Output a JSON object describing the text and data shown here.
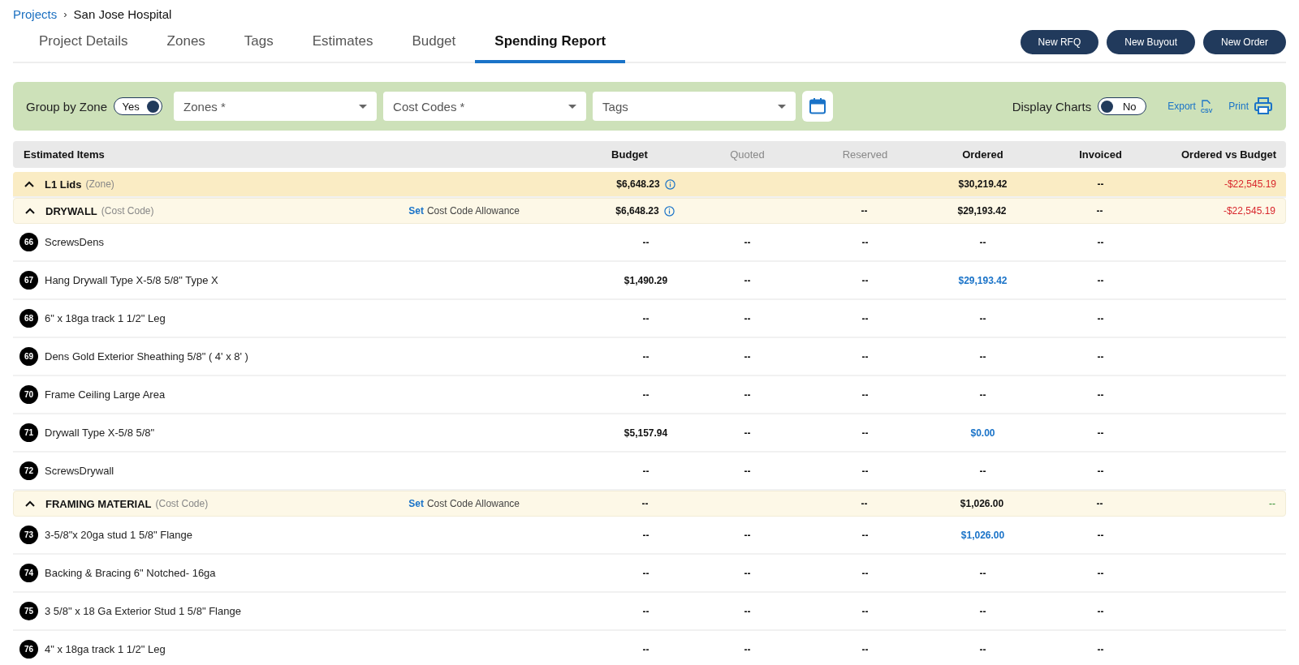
{
  "breadcrumb": {
    "link": "Projects",
    "separator": "›",
    "current": "San Jose Hospital"
  },
  "tabs": [
    {
      "label": "Project Details",
      "selected": false
    },
    {
      "label": "Zones",
      "selected": false
    },
    {
      "label": "Tags",
      "selected": false
    },
    {
      "label": "Estimates",
      "selected": false
    },
    {
      "label": "Budget",
      "selected": false
    },
    {
      "label": "Spending Report",
      "selected": true
    }
  ],
  "actions": [
    "New RFQ",
    "New Buyout",
    "New Order"
  ],
  "filters": {
    "group_by_zone": {
      "label": "Group by Zone",
      "value": "Yes",
      "on": true
    },
    "selects": [
      {
        "placeholder": "Zones *"
      },
      {
        "placeholder": "Cost Codes *"
      },
      {
        "placeholder": "Tags"
      }
    ],
    "display_charts": {
      "label": "Display Charts",
      "value": "No",
      "on": false
    },
    "export": "Export",
    "export_badge": "CSV",
    "print": "Print"
  },
  "table": {
    "name_column": "Estimated Items",
    "columns": [
      {
        "label": "Budget",
        "disabled": false
      },
      {
        "label": "Quoted",
        "disabled": true
      },
      {
        "label": "Reserved",
        "disabled": true
      },
      {
        "label": "Ordered",
        "disabled": false
      },
      {
        "label": "Invoiced",
        "disabled": false
      },
      {
        "label": "Ordered vs Budget",
        "disabled": false
      }
    ],
    "rows": [
      {
        "kind": "zone",
        "name": "L1 Lids",
        "tag": "(Zone)",
        "expanded": true,
        "budget_info": true,
        "cells": [
          "$6,648.23",
          null,
          null,
          "$30,219.42",
          "--",
          {
            "text": "-$22,545.19",
            "kind": "negative"
          }
        ]
      },
      {
        "kind": "costcode",
        "name": "DRYWALL",
        "tag": "(Cost Code)",
        "expanded": true,
        "allowance": {
          "action": "Set",
          "label": "Cost Code Allowance"
        },
        "budget_info": true,
        "cells": [
          "$6,648.23",
          null,
          "--",
          "$29,193.42",
          "--",
          {
            "text": "-$22,545.19",
            "kind": "negative"
          }
        ]
      },
      {
        "kind": "item",
        "number": "66",
        "name": "ScrewsDens",
        "cells": [
          "--",
          "--",
          "--",
          "--",
          "--",
          null
        ]
      },
      {
        "kind": "item",
        "number": "67",
        "name": "Hang Drywall Type X-5/8 5/8\" Type X",
        "cells": [
          "$1,490.29",
          "--",
          "--",
          {
            "text": "$29,193.42",
            "kind": "link"
          },
          "--",
          null
        ]
      },
      {
        "kind": "item",
        "number": "68",
        "name": "6\" x 18ga track 1 1/2\" Leg",
        "cells": [
          "--",
          "--",
          "--",
          "--",
          "--",
          null
        ]
      },
      {
        "kind": "item",
        "number": "69",
        "name": "Dens Gold Exterior Sheathing 5/8\" ( 4' x 8' )",
        "cells": [
          "--",
          "--",
          "--",
          "--",
          "--",
          null
        ]
      },
      {
        "kind": "item",
        "number": "70",
        "name": "Frame Ceiling Large Area",
        "cells": [
          "--",
          "--",
          "--",
          "--",
          "--",
          null
        ]
      },
      {
        "kind": "item",
        "number": "71",
        "name": "Drywall Type X-5/8 5/8\"",
        "cells": [
          "$5,157.94",
          "--",
          "--",
          {
            "text": "$0.00",
            "kind": "link"
          },
          "--",
          null
        ]
      },
      {
        "kind": "item",
        "number": "72",
        "name": "ScrewsDrywall",
        "cells": [
          "--",
          "--",
          "--",
          "--",
          "--",
          null
        ]
      },
      {
        "kind": "costcode",
        "name": "FRAMING MATERIAL",
        "tag": "(Cost Code)",
        "expanded": true,
        "allowance": {
          "action": "Set",
          "label": "Cost Code Allowance"
        },
        "budget_info": false,
        "cells": [
          "--",
          null,
          "--",
          "$1,026.00",
          "--",
          {
            "text": "--",
            "kind": "positive"
          }
        ]
      },
      {
        "kind": "item",
        "number": "73",
        "name": "3-5/8\"x 20ga stud 1 5/8\" Flange",
        "cells": [
          "--",
          "--",
          "--",
          {
            "text": "$1,026.00",
            "kind": "link"
          },
          "--",
          null
        ]
      },
      {
        "kind": "item",
        "number": "74",
        "name": "Backing & Bracing 6\" Notched- 16ga",
        "cells": [
          "--",
          "--",
          "--",
          "--",
          "--",
          null
        ]
      },
      {
        "kind": "item",
        "number": "75",
        "name": "3 5/8\" x 18 Ga Exterior Stud 1 5/8\" Flange",
        "cells": [
          "--",
          "--",
          "--",
          "--",
          "--",
          null
        ]
      },
      {
        "kind": "item",
        "number": "76",
        "name": "4\" x 18ga track 1 1/2\" Leg",
        "cells": [
          "--",
          "--",
          "--",
          "--",
          "--",
          null
        ]
      }
    ]
  }
}
